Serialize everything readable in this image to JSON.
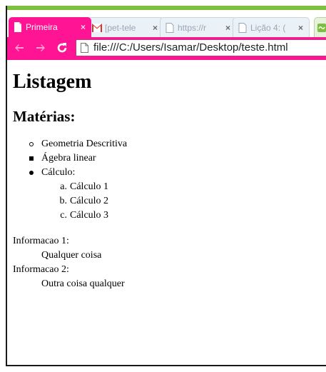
{
  "browser": {
    "tabs": [
      {
        "label": "Primeira",
        "icon": "page-icon",
        "active": true
      },
      {
        "label": "[pet-tele",
        "icon": "gmail-icon",
        "active": false
      },
      {
        "label": "https://r",
        "icon": "page-icon",
        "active": false
      },
      {
        "label": "Lição 4: (",
        "icon": "page-icon",
        "active": false
      }
    ],
    "close_glyph": "×",
    "url": "file:///C:/Users/Isamar/Desktop/teste.html",
    "accent_color": "#ff1493",
    "stripe_color": "#7fbf3f"
  },
  "page": {
    "title": "Listagem",
    "subtitle": "Matérias:",
    "materias": [
      "Geometria Descritiva",
      "Ágebra linear",
      "Cálculo:"
    ],
    "calculos": {
      "markers": [
        "a.",
        "b.",
        "c."
      ],
      "items": [
        "Cálculo 1",
        "Cálculo 2",
        "Cálculo 3"
      ]
    },
    "infos": [
      {
        "term": "Informacao 1:",
        "desc": "Qualquer coisa"
      },
      {
        "term": "Informacao 2:",
        "desc": "Outra coisa qualquer"
      }
    ]
  }
}
